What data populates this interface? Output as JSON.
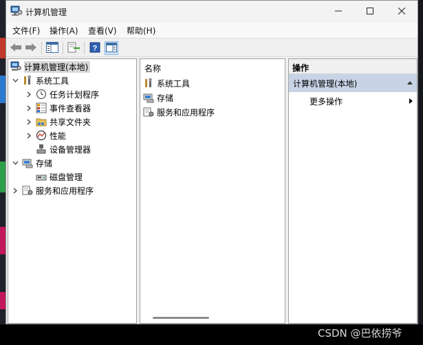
{
  "window": {
    "title": "计算机管理",
    "title_icon": "computer-management-icon",
    "controls": [
      "minimize-icon",
      "maximize-icon",
      "close-icon"
    ]
  },
  "menubar": {
    "items": [
      "文件(F)",
      "操作(A)",
      "查看(V)",
      "帮助(H)"
    ]
  },
  "toolbar": {
    "buttons": [
      "back-arrow-icon",
      "forward-arrow-icon",
      "show-hide-tree-icon",
      "export-list-icon",
      "help-icon",
      "show-hide-action-pane-icon"
    ]
  },
  "tree": {
    "root": "计算机管理(本地)",
    "system_tools": "系统工具",
    "task_scheduler": "任务计划程序",
    "event_viewer": "事件查看器",
    "shared_folders": "共享文件夹",
    "performance": "性能",
    "device_manager": "设备管理器",
    "storage": "存储",
    "disk_management": "磁盘管理",
    "services_apps": "服务和应用程序"
  },
  "list": {
    "header": "名称",
    "items": [
      "系统工具",
      "存储",
      "服务和应用程序"
    ]
  },
  "actions": {
    "header": "操作",
    "section": "计算机管理(本地)",
    "more": "更多操作"
  },
  "watermark": "CSDN @巴依捞爷",
  "colors": {
    "selection": "#c8d4e6",
    "tree_selected": "#d9d9d9",
    "window_bg": "#f0f0f0"
  }
}
